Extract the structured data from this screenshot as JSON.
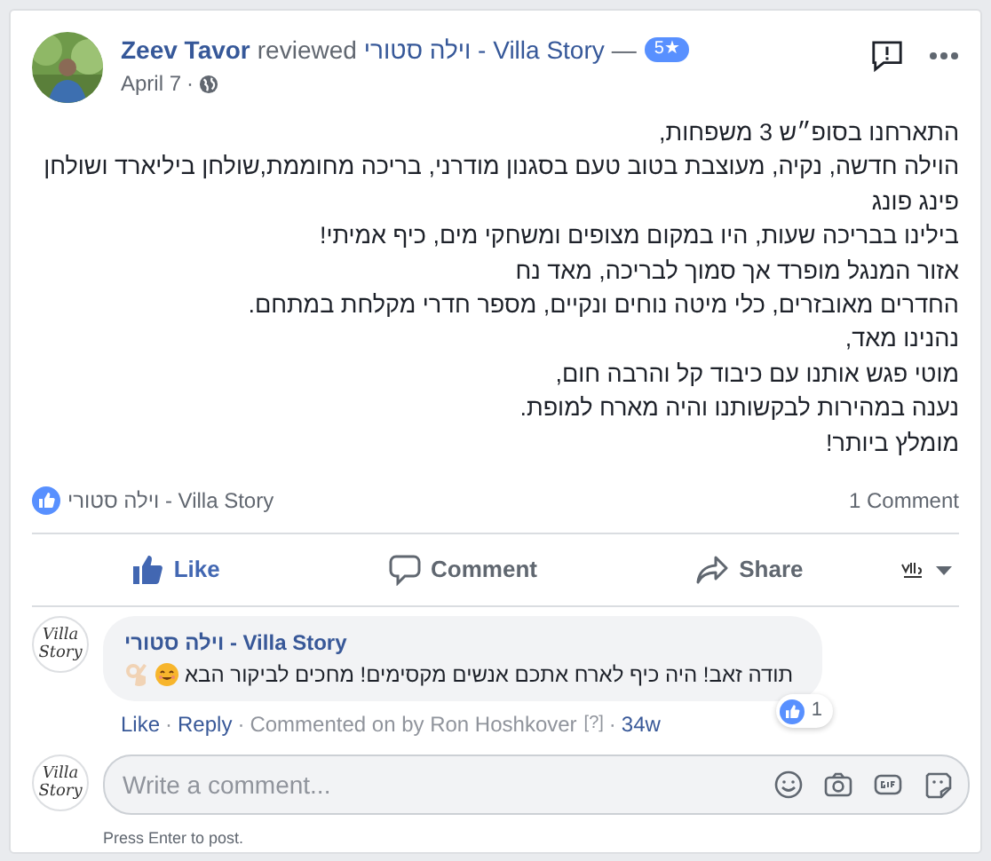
{
  "post": {
    "author": "Zeev Tavor",
    "verb": "reviewed",
    "page": "וילה סטורי - Villa Story",
    "dash": "—",
    "rating": "5★",
    "date": "April 7",
    "separator": "·",
    "body_lines": [
      "התארחנו בסופ״ש 3 משפחות,",
      "הוילה חדשה, נקיה, מעוצבת בטוב טעם בסגנון מודרני, בריכה מחוממת,שולחן ביליארד ושולחן פינג פונג",
      "בילינו בבריכה שעות, היו במקום מצופים ומשחקי מים, כיף אמיתי!",
      "אזור המנגל מופרד אך סמוך לבריכה, מאד נח",
      "החדרים מאובזרים, כלי מיטה נוחים ונקיים, מספר חדרי מקלחת במתחם.",
      "נהנינו מאד,",
      "מוטי פגש אותנו עם כיבוד קל והרבה חום,",
      "נענה במהירות לבקשותנו והיה מארח למופת.",
      "מומלץ ביותר!"
    ],
    "likers": "וילה סטורי - Villa Story",
    "comment_count": "1 Comment"
  },
  "actions": {
    "like": {
      "label": "Like",
      "selected": true
    },
    "comment": {
      "label": "Comment",
      "selected": false
    },
    "share": {
      "label": "Share",
      "selected": false
    }
  },
  "comment_logo": [
    "Villa",
    "Story"
  ],
  "composer_logo": [
    "Villa",
    "Story"
  ],
  "comment": {
    "author": "וילה סטורי - Villa Story",
    "text": "תודה זאב! היה כיף לארח אתכם אנשים מקסימים! מחכים לביקור הבא",
    "reaction_count": "1",
    "like_link": "Like",
    "reply_link": "Reply",
    "meta": "Commented on by Ron Hoshkover",
    "help": "[?]",
    "age": "34w"
  },
  "composer": {
    "placeholder": "Write a comment...",
    "hint": "Press Enter to post."
  }
}
